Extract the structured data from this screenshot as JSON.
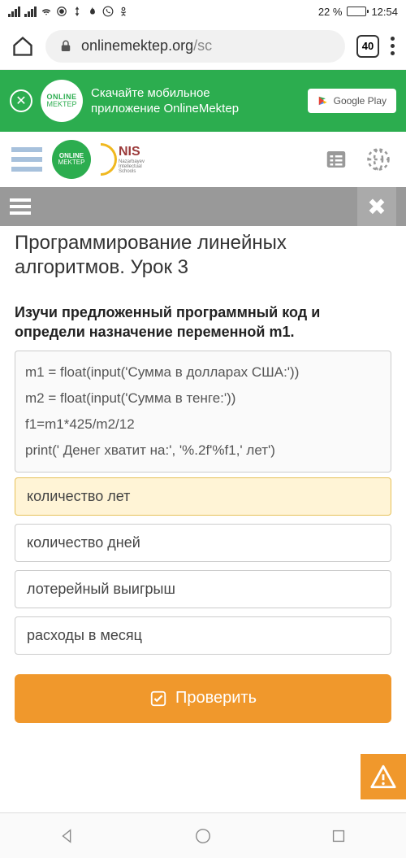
{
  "status_bar": {
    "battery_pct": "22 %",
    "time": "12:54"
  },
  "browser": {
    "url_host": "onlinemektep.org",
    "url_path": "/sc",
    "tab_count": "40"
  },
  "banner": {
    "logo_top": "ONLINE",
    "logo_bottom": "MEKTEP",
    "text_line1": "Скачайте мобильное",
    "text_line2": "приложение OnlineMektep",
    "store_label": "Google Play"
  },
  "site_header": {
    "logo_top": "ONLINE",
    "logo_bottom": "MEKTEP",
    "nis_label": "NIS",
    "nis_sub1": "Nazarbayev",
    "nis_sub2": "Intellectual",
    "nis_sub3": "Schools"
  },
  "lesson": {
    "title": "Программирование линейных алгоритмов. Урок 3",
    "question": "Изучи предложенный программный код и определи назначение переменной m1.",
    "code": [
      "m1 = float(input('Сумма в долларах США:'))",
      "m2 = float(input('Сумма в тенге:'))",
      "f1=m1*425/m2/12",
      "print(' Денег хватит на:', '%.2f'%f1,' лет')"
    ],
    "answers": [
      "количество лет",
      "количество дней",
      "лотерейный выигрыш",
      "расходы в месяц"
    ],
    "selected_index": 0,
    "check_label": "Проверить"
  }
}
